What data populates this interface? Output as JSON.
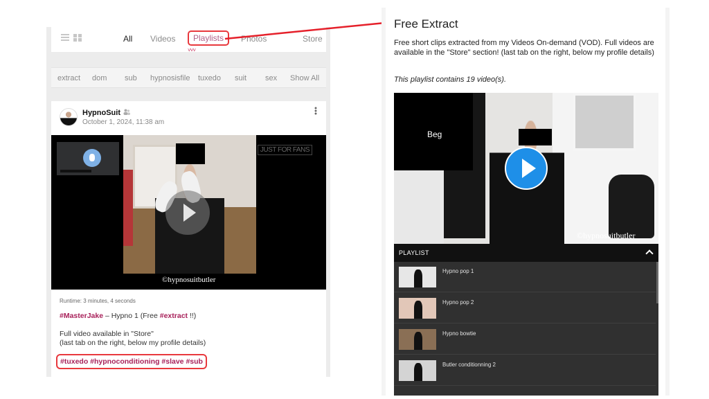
{
  "left": {
    "tabs": [
      {
        "label": "All"
      },
      {
        "label": "Videos"
      },
      {
        "label": "Playlists"
      },
      {
        "label": "Photos"
      },
      {
        "label": "Store"
      }
    ],
    "chevron": "˅˅˅",
    "tags": [
      "extract",
      "dom",
      "sub",
      "hypnosisfile",
      "tuxedo",
      "suit",
      "sex",
      "Show All"
    ],
    "post": {
      "author": "HypnoSuit",
      "date": "October 1, 2024, 11:38 am",
      "video_watermark": "©hypnosuitbutler",
      "logo_text": "JUST FOR FANS",
      "runtime": "Runtime: 3 minutes, 4 seconds",
      "caption": {
        "hashtag1": "#MasterJake",
        "middle": " – Hypno 1 (Free ",
        "hashtag2": "#extract",
        "end": " !!)"
      },
      "desc_line1": "Full video available in \"Store\"",
      "desc_line2": "(last tab on the right, below my profile details)",
      "hashtags": "#tuxedo #hypnoconditioning #slave #sub"
    }
  },
  "right": {
    "title": "Free Extract",
    "description": "Free short clips extracted from my Videos On-demand (VOD). Full videos are available in the \"Store\" section! (last tab on the right, below my profile details)",
    "count": "This playlist contains 19 video(s).",
    "video_overlay_text": "Beg",
    "watermark": "©hypnosuitbutler",
    "playlist_header": "PLAYLIST",
    "items": [
      {
        "title": "Hypno pop 1"
      },
      {
        "title": "Hypno pop 2"
      },
      {
        "title": "Hypno bowtie"
      },
      {
        "title": "Butler conditionning 2"
      }
    ]
  },
  "colors": {
    "highlight": "#e8383d",
    "hashtag": "#a8215a",
    "play_button": "#1e8fe8"
  }
}
